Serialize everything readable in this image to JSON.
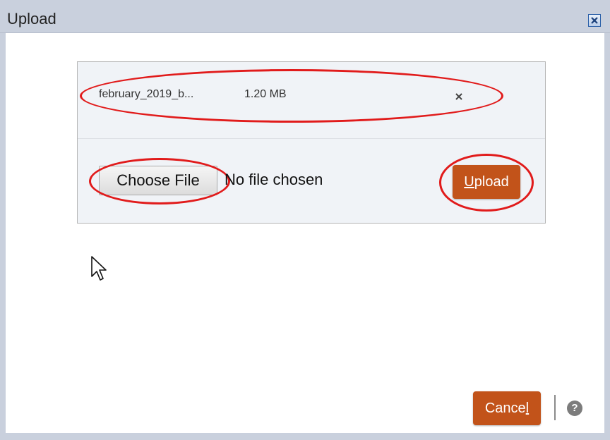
{
  "dialog": {
    "title": "Upload",
    "close_icon": "close-icon"
  },
  "file": {
    "name": "february_2019_b...",
    "size": "1.20 MB",
    "remove_icon": "close-icon"
  },
  "chooser": {
    "button_label": "Choose File",
    "status": "No file chosen"
  },
  "upload_button": {
    "mnemonic": "U",
    "rest": "pload"
  },
  "footer": {
    "cancel_main": "Cance",
    "cancel_mnemonic": "l",
    "help_icon": "help-icon",
    "help_glyph": "?"
  },
  "colors": {
    "accent": "#c2531a",
    "titlebar": "#c9d0dd",
    "annotation": "#e11b1b"
  }
}
